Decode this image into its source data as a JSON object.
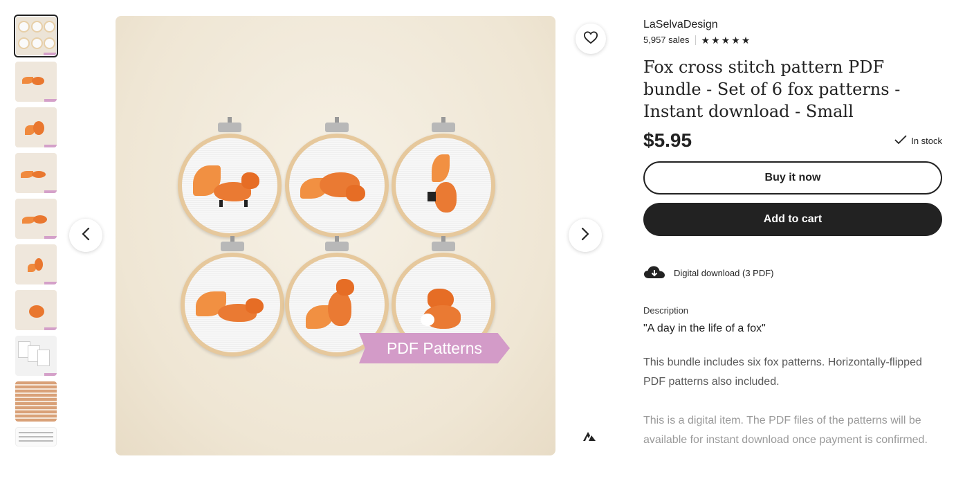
{
  "shop": {
    "name": "LaSelvaDesign",
    "sales": "5,957 sales",
    "rating_stars": 5
  },
  "listing": {
    "title": "Fox cross stitch pattern PDF bundle - Set of 6 fox patterns - Instant download - Small",
    "price": "$5.95",
    "stock_status": "In stock"
  },
  "buttons": {
    "buy_now": "Buy it now",
    "add_to_cart": "Add to cart"
  },
  "download": {
    "label": "Digital download (3 PDF)"
  },
  "description": {
    "label": "Description",
    "quote": "\"A day in the life of a fox\"",
    "paragraph1": "This bundle includes six fox patterns. Horizontally-flipped PDF patterns also included.",
    "paragraph2": "This is a digital item. The PDF files of the patterns will be available for instant download once payment is confirmed."
  },
  "image": {
    "banner_text": "PDF Patterns"
  },
  "icons": {
    "favorite": "heart-icon",
    "prev": "chevron-left-icon",
    "next": "chevron-right-icon",
    "stock": "check-icon",
    "download": "cloud-download-icon",
    "brand": "brand-logo-icon"
  },
  "colors": {
    "primary_button": "#222222",
    "banner": "#d39bc8",
    "fox_orange": "#ea7a33"
  }
}
